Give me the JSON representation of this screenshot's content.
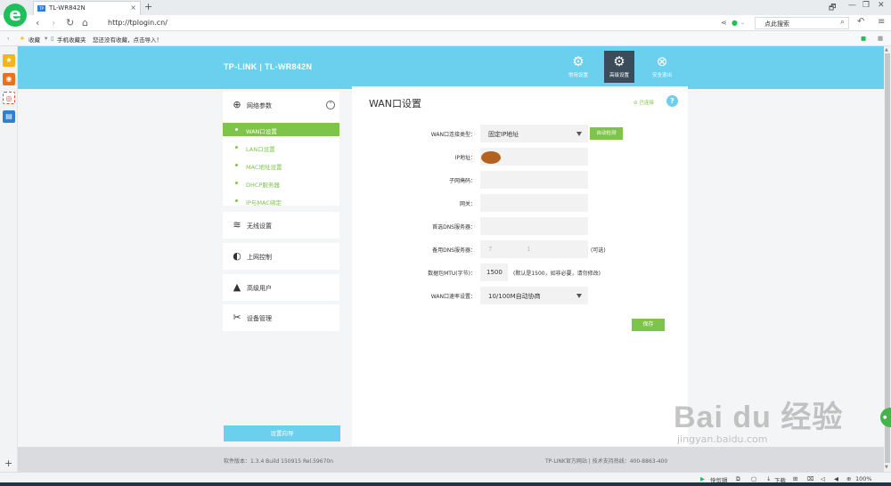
{
  "browser": {
    "tab": {
      "title": "TL-WR842N",
      "favicon": "TP",
      "close": "×"
    },
    "new_tab": "+",
    "window": {
      "restore": "🗗",
      "minimize": "—",
      "maximize": "❐",
      "close": "✕"
    },
    "address": "http://tplogin.cn/",
    "search_placeholder": "点此搜索",
    "bookmarks": {
      "favorites": "收藏",
      "mobile": "手机收藏夹",
      "hint": "您还没有收藏，点击导入！"
    },
    "side_add": "+"
  },
  "router": {
    "brand": "TP-LINK",
    "model": "TL-WR842N",
    "top_nav": [
      {
        "label": "常用设置",
        "icon": "gear-icon"
      },
      {
        "label": "高级设置",
        "icon": "gears-icon"
      },
      {
        "label": "安全退出",
        "icon": "exit-icon"
      }
    ],
    "menu": {
      "network": "网络参数",
      "submenu": [
        "WAN口设置",
        "LAN口设置",
        "MAC地址设置",
        "DHCP服务器",
        "IP与MAC绑定"
      ],
      "wireless": "无线设置",
      "internet_control": "上网控制",
      "advanced_users": "高级用户",
      "device_management": "设备管理",
      "setup_wizard": "设置向导"
    },
    "panel": {
      "title": "WAN口设置",
      "status": "已连接",
      "help": "?",
      "fields": {
        "conn_type_label": "WAN口连接类型：",
        "conn_type_value": "固定IP地址",
        "auto_detect": "自动检测",
        "ip_label": "IP地址：",
        "subnet_label": "子网掩码：",
        "gateway_label": "网关：",
        "dns1_label": "首选DNS服务器：",
        "dns2_label": "备用DNS服务器：",
        "dns2_value_a": "7",
        "dns2_value_b": "1",
        "dns2_hint": "(可选)",
        "mtu_label": "数据包MTU(字节)：",
        "mtu_value": "1500",
        "mtu_hint": "(默认是1500，如非必要，请勿修改)",
        "speed_label": "WAN口速率设置：",
        "speed_value": "10/100M自动协商"
      },
      "save": "保存"
    },
    "footer": {
      "version": "软件版本：1.3.4 Build 150915 Rel.59670n",
      "links": "TP-LINK官方网站  |  技术支持热线：400-8863-400"
    }
  },
  "statusbar": {
    "quick_clip": "快剪辑",
    "download": "下载",
    "zoom": "100%"
  },
  "watermark": {
    "logo": "Bai du 经验",
    "site": "jingyan.baidu.com"
  },
  "colors": {
    "header": "#6bcfee",
    "accent_green": "#7cc44a",
    "nav_active": "#3a4c59"
  }
}
